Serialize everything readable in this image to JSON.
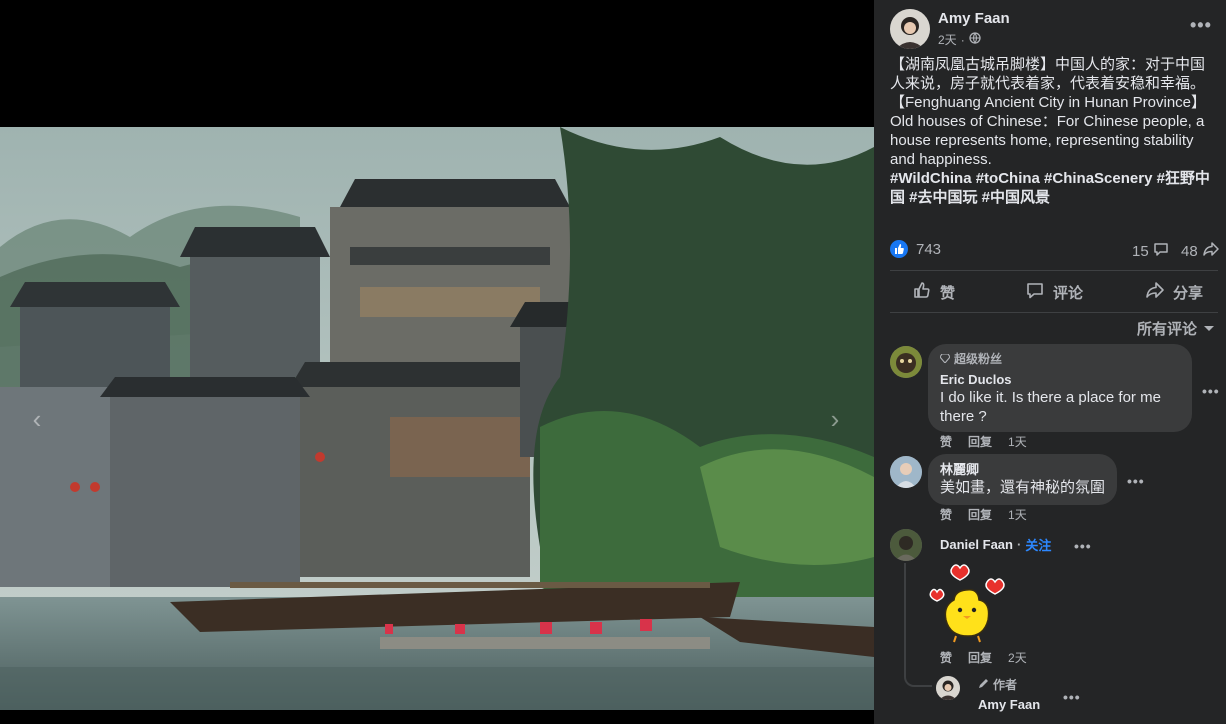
{
  "post": {
    "author": "Amy Faan",
    "time": "2天",
    "separator": "·",
    "text_lines": [
      "【湖南凤凰古城吊脚楼】中国人的家：对于中国人来说，房子就代表着家，代表着安稳和幸福。",
      "【Fenghuang Ancient City in Hunan Province】Old houses of Chinese：For Chinese people, a house represents home, representing stability and happiness."
    ],
    "hashtags": "#WildChina #toChina #ChinaScenery #狂野中国 #去中国玩 #中国风景",
    "reactions_count": "743",
    "comments_count": "15",
    "shares_count": "48",
    "actions": {
      "like": "赞",
      "comment": "评论",
      "share": "分享"
    },
    "sort_label": "所有评论"
  },
  "comments": [
    {
      "badge": "超级粉丝",
      "author": "Eric Duclos",
      "text": "I do like it. Is there a place for me there ?",
      "like": "赞",
      "reply": "回复",
      "time": "1天"
    },
    {
      "author": "林麗卿",
      "text": "美如畫，還有神秘的氛圍",
      "like": "赞",
      "reply": "回复",
      "time": "1天"
    },
    {
      "author": "Daniel Faan",
      "follow": "关注",
      "follow_sep": "·",
      "like": "赞",
      "reply": "回复",
      "time": "2天"
    }
  ],
  "reply": {
    "badge": "作者",
    "author": "Amy Faan"
  },
  "colors": {
    "panel_bg": "#242526",
    "bubble_bg": "#3a3b3c",
    "text_primary": "#e4e6eb",
    "text_secondary": "#b0b3b8",
    "like_blue": "#1877f2",
    "follow_blue": "#2d88ff"
  }
}
